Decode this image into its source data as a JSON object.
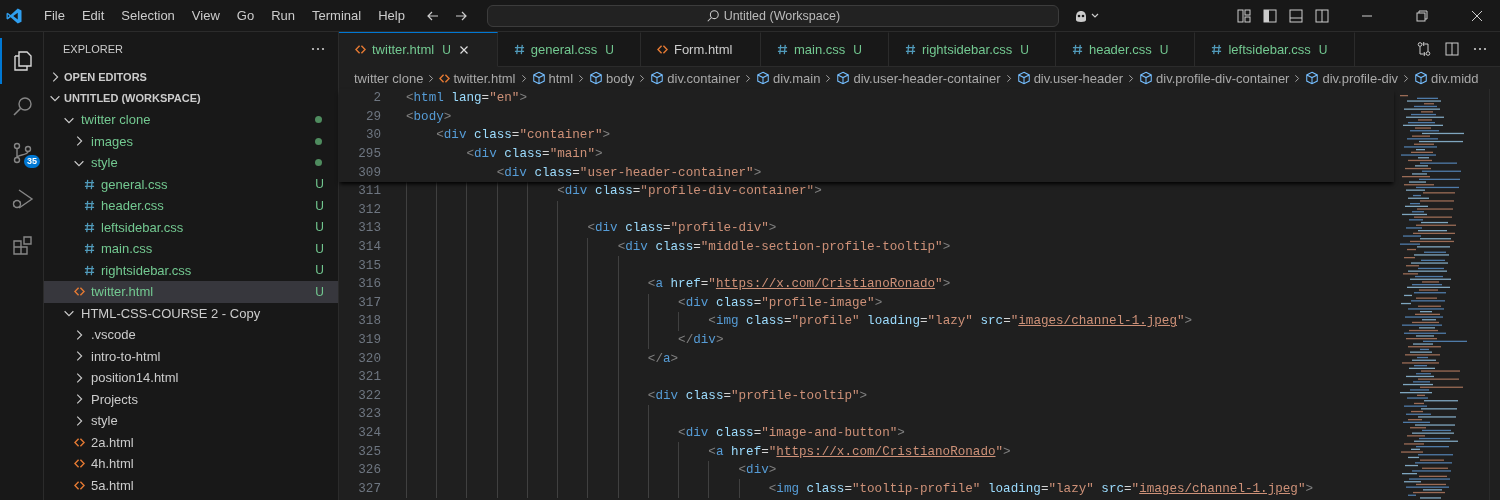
{
  "menu": [
    "File",
    "Edit",
    "Selection",
    "View",
    "Go",
    "Run",
    "Terminal",
    "Help"
  ],
  "command_center": {
    "label": "Untitled (Workspace)"
  },
  "activity_bar": [
    {
      "kind": "explorer",
      "selected": true
    },
    {
      "kind": "search",
      "selected": false
    },
    {
      "kind": "scm",
      "selected": false,
      "badge": "35"
    },
    {
      "kind": "debug",
      "selected": false
    },
    {
      "kind": "extensions",
      "selected": false
    }
  ],
  "explorer": {
    "title": "EXPLORER",
    "sections": [
      {
        "label": "OPEN EDITORS",
        "expanded": false
      },
      {
        "label": "UNTITLED (WORKSPACE)",
        "expanded": true,
        "items": [
          {
            "name": "twitter clone",
            "kind": "folder",
            "expanded": true,
            "untracked": true,
            "dot": true,
            "selected": false,
            "children": [
              {
                "name": "images",
                "kind": "folder",
                "expanded": false,
                "untracked": true,
                "dot": true,
                "selected": false
              },
              {
                "name": "style",
                "kind": "folder",
                "expanded": true,
                "untracked": true,
                "dot": true,
                "selected": false,
                "children": [
                  {
                    "name": "general.css",
                    "kind": "css",
                    "untracked": true,
                    "decoration": "U",
                    "selected": false
                  },
                  {
                    "name": "header.css",
                    "kind": "css",
                    "untracked": true,
                    "decoration": "U",
                    "selected": false
                  },
                  {
                    "name": "leftsidebar.css",
                    "kind": "css",
                    "untracked": true,
                    "decoration": "U",
                    "selected": false
                  },
                  {
                    "name": "main.css",
                    "kind": "css",
                    "untracked": true,
                    "decoration": "U",
                    "selected": false
                  },
                  {
                    "name": "rightsidebar.css",
                    "kind": "css",
                    "untracked": true,
                    "decoration": "U",
                    "selected": false
                  }
                ]
              },
              {
                "name": "twitter.html",
                "kind": "html",
                "untracked": true,
                "decoration": "U",
                "selected": true
              }
            ]
          },
          {
            "name": "HTML-CSS-COURSE 2 - Copy",
            "kind": "folder",
            "expanded": true,
            "untracked": false,
            "dot": false,
            "selected": false,
            "children": [
              {
                "name": ".vscode",
                "kind": "folder",
                "expanded": false,
                "untracked": false,
                "dot": false,
                "selected": false
              },
              {
                "name": "intro-to-html",
                "kind": "folder",
                "expanded": false,
                "untracked": false,
                "dot": false,
                "selected": false
              },
              {
                "name": "position14.html",
                "kind": "folder",
                "expanded": false,
                "untracked": false,
                "dot": false,
                "selected": false
              },
              {
                "name": "Projects",
                "kind": "folder",
                "expanded": false,
                "untracked": false,
                "dot": false,
                "selected": false
              },
              {
                "name": "style",
                "kind": "folder",
                "expanded": false,
                "untracked": false,
                "dot": false,
                "selected": false
              },
              {
                "name": "2a.html",
                "kind": "html",
                "untracked": false,
                "selected": false
              },
              {
                "name": "4h.html",
                "kind": "html",
                "untracked": false,
                "selected": false
              },
              {
                "name": "5a.html",
                "kind": "html",
                "untracked": false,
                "selected": false
              }
            ]
          }
        ]
      }
    ]
  },
  "tabs": [
    {
      "label": "twitter.html",
      "kind": "html",
      "untracked": true,
      "decoration": "U",
      "selected": true
    },
    {
      "label": "general.css",
      "kind": "css",
      "untracked": true,
      "decoration": "U",
      "selected": false
    },
    {
      "label": "Form.html",
      "kind": "html",
      "untracked": false,
      "selected": false
    },
    {
      "label": "main.css",
      "kind": "css",
      "untracked": true,
      "decoration": "U",
      "selected": false
    },
    {
      "label": "rightsidebar.css",
      "kind": "css",
      "untracked": true,
      "decoration": "U",
      "selected": false
    },
    {
      "label": "header.css",
      "kind": "css",
      "untracked": true,
      "decoration": "U",
      "selected": false
    },
    {
      "label": "leftsidebar.css",
      "kind": "css",
      "untracked": true,
      "decoration": "U",
      "selected": false
    }
  ],
  "breadcrumbs": [
    {
      "label": "twitter clone",
      "kind": "folder"
    },
    {
      "label": "twitter.html",
      "kind": "html"
    },
    {
      "label": "html",
      "kind": "element"
    },
    {
      "label": "body",
      "kind": "element"
    },
    {
      "label": "div.container",
      "kind": "element"
    },
    {
      "label": "div.main",
      "kind": "element"
    },
    {
      "label": "div.user-header-container",
      "kind": "element"
    },
    {
      "label": "div.user-header",
      "kind": "element"
    },
    {
      "label": "div.profile-div-container",
      "kind": "element"
    },
    {
      "label": "div.profile-div",
      "kind": "element"
    },
    {
      "label": "div.midd",
      "kind": "element"
    }
  ],
  "editor": {
    "sticky_lines": [
      {
        "number": "2",
        "tokens": [
          {
            "kind": "p",
            "text": "<"
          },
          {
            "kind": "tag",
            "text": "html"
          },
          {
            "kind": "attr",
            "text": " lang"
          },
          {
            "kind": "eq",
            "text": "="
          },
          {
            "kind": "str",
            "text": "\"en\""
          },
          {
            "kind": "p",
            "text": ">"
          }
        ]
      },
      {
        "number": "29",
        "tokens": [
          {
            "kind": "p",
            "text": "<"
          },
          {
            "kind": "tag",
            "text": "body"
          },
          {
            "kind": "p",
            "text": ">"
          }
        ]
      },
      {
        "number": "30",
        "tokens": [
          {
            "kind": "p",
            "text": "    <"
          },
          {
            "kind": "tag",
            "text": "div"
          },
          {
            "kind": "attr",
            "text": " class"
          },
          {
            "kind": "eq",
            "text": "="
          },
          {
            "kind": "str",
            "text": "\"container\""
          },
          {
            "kind": "p",
            "text": ">"
          }
        ]
      },
      {
        "number": "295",
        "tokens": [
          {
            "kind": "p",
            "text": "        <"
          },
          {
            "kind": "tag",
            "text": "div"
          },
          {
            "kind": "attr",
            "text": " class"
          },
          {
            "kind": "eq",
            "text": "="
          },
          {
            "kind": "str",
            "text": "\"main\""
          },
          {
            "kind": "p",
            "text": ">"
          }
        ]
      },
      {
        "number": "309",
        "tokens": [
          {
            "kind": "p",
            "text": "            <"
          },
          {
            "kind": "tag",
            "text": "div"
          },
          {
            "kind": "attr",
            "text": " class"
          },
          {
            "kind": "eq",
            "text": "="
          },
          {
            "kind": "str",
            "text": "\"user-header-container\""
          },
          {
            "kind": "p",
            "text": ">"
          }
        ]
      }
    ],
    "lines": [
      {
        "number": "311",
        "tokens": [
          {
            "kind": "p",
            "text": "                    <"
          },
          {
            "kind": "tag",
            "text": "div"
          },
          {
            "kind": "attr",
            "text": " class"
          },
          {
            "kind": "eq",
            "text": "="
          },
          {
            "kind": "str",
            "text": "\"profile-div-container\""
          },
          {
            "kind": "p",
            "text": ">"
          }
        ]
      },
      {
        "number": "312"
      },
      {
        "number": "313",
        "tokens": [
          {
            "kind": "p",
            "text": "                        <"
          },
          {
            "kind": "tag",
            "text": "div"
          },
          {
            "kind": "attr",
            "text": " class"
          },
          {
            "kind": "eq",
            "text": "="
          },
          {
            "kind": "str",
            "text": "\"profile-div\""
          },
          {
            "kind": "p",
            "text": ">"
          }
        ]
      },
      {
        "number": "314",
        "tokens": [
          {
            "kind": "p",
            "text": "                            <"
          },
          {
            "kind": "tag",
            "text": "div"
          },
          {
            "kind": "attr",
            "text": " class"
          },
          {
            "kind": "eq",
            "text": "="
          },
          {
            "kind": "str",
            "text": "\"middle-section-profile-tooltip\""
          },
          {
            "kind": "p",
            "text": ">"
          }
        ]
      },
      {
        "number": "315"
      },
      {
        "number": "316",
        "tokens": [
          {
            "kind": "p",
            "text": "                                <"
          },
          {
            "kind": "tag",
            "text": "a"
          },
          {
            "kind": "attr",
            "text": " href"
          },
          {
            "kind": "eq",
            "text": "="
          },
          {
            "kind": "str",
            "text": "\""
          },
          {
            "kind": "link",
            "text": "https://x.com/CristianoRonado"
          },
          {
            "kind": "str",
            "text": "\""
          },
          {
            "kind": "p",
            "text": ">"
          }
        ]
      },
      {
        "number": "317",
        "tokens": [
          {
            "kind": "p",
            "text": "                                    <"
          },
          {
            "kind": "tag",
            "text": "div"
          },
          {
            "kind": "attr",
            "text": " class"
          },
          {
            "kind": "eq",
            "text": "="
          },
          {
            "kind": "str",
            "text": "\"profile-image\""
          },
          {
            "kind": "p",
            "text": ">"
          }
        ]
      },
      {
        "number": "318",
        "tokens": [
          {
            "kind": "p",
            "text": "                                        <"
          },
          {
            "kind": "tag",
            "text": "img"
          },
          {
            "kind": "attr",
            "text": " class"
          },
          {
            "kind": "eq",
            "text": "="
          },
          {
            "kind": "str",
            "text": "\"profile\""
          },
          {
            "kind": "attr",
            "text": " loading"
          },
          {
            "kind": "eq",
            "text": "="
          },
          {
            "kind": "str",
            "text": "\"lazy\""
          },
          {
            "kind": "attr",
            "text": " src"
          },
          {
            "kind": "eq",
            "text": "="
          },
          {
            "kind": "str",
            "text": "\""
          },
          {
            "kind": "link",
            "text": "images/channel-1.jpeg"
          },
          {
            "kind": "str",
            "text": "\""
          },
          {
            "kind": "p",
            "text": ">"
          }
        ]
      },
      {
        "number": "319",
        "tokens": [
          {
            "kind": "p",
            "text": "                                    </"
          },
          {
            "kind": "tag",
            "text": "div"
          },
          {
            "kind": "p",
            "text": ">"
          }
        ]
      },
      {
        "number": "320",
        "tokens": [
          {
            "kind": "p",
            "text": "                                </"
          },
          {
            "kind": "tag",
            "text": "a"
          },
          {
            "kind": "p",
            "text": ">"
          }
        ]
      },
      {
        "number": "321"
      },
      {
        "number": "322",
        "tokens": [
          {
            "kind": "p",
            "text": "                                <"
          },
          {
            "kind": "tag",
            "text": "div"
          },
          {
            "kind": "attr",
            "text": " class"
          },
          {
            "kind": "eq",
            "text": "="
          },
          {
            "kind": "str",
            "text": "\"profile-tooltip\""
          },
          {
            "kind": "p",
            "text": ">"
          }
        ]
      },
      {
        "number": "323"
      },
      {
        "number": "324",
        "tokens": [
          {
            "kind": "p",
            "text": "                                    <"
          },
          {
            "kind": "tag",
            "text": "div"
          },
          {
            "kind": "attr",
            "text": " class"
          },
          {
            "kind": "eq",
            "text": "="
          },
          {
            "kind": "str",
            "text": "\"image-and-button\""
          },
          {
            "kind": "p",
            "text": ">"
          }
        ]
      },
      {
        "number": "325",
        "tokens": [
          {
            "kind": "p",
            "text": "                                        <"
          },
          {
            "kind": "tag",
            "text": "a"
          },
          {
            "kind": "attr",
            "text": " href"
          },
          {
            "kind": "eq",
            "text": "="
          },
          {
            "kind": "str",
            "text": "\""
          },
          {
            "kind": "link",
            "text": "https://x.com/CristianoRonado"
          },
          {
            "kind": "str",
            "text": "\""
          },
          {
            "kind": "p",
            "text": ">"
          }
        ]
      },
      {
        "number": "326",
        "tokens": [
          {
            "kind": "p",
            "text": "                                            <"
          },
          {
            "kind": "tag",
            "text": "div"
          },
          {
            "kind": "p",
            "text": ">"
          }
        ]
      },
      {
        "number": "327",
        "tokens": [
          {
            "kind": "p",
            "text": "                                                <"
          },
          {
            "kind": "tag",
            "text": "img"
          },
          {
            "kind": "attr",
            "text": " class"
          },
          {
            "kind": "eq",
            "text": "="
          },
          {
            "kind": "str",
            "text": "\"tooltip-profile\""
          },
          {
            "kind": "attr",
            "text": " loading"
          },
          {
            "kind": "eq",
            "text": "="
          },
          {
            "kind": "str",
            "text": "\"lazy\""
          },
          {
            "kind": "attr",
            "text": " src"
          },
          {
            "kind": "eq",
            "text": "="
          },
          {
            "kind": "str",
            "text": "\""
          },
          {
            "kind": "link",
            "text": "images/channel-1.jpeg"
          },
          {
            "kind": "str",
            "text": "\""
          },
          {
            "kind": "p",
            "text": ">"
          }
        ]
      }
    ]
  }
}
